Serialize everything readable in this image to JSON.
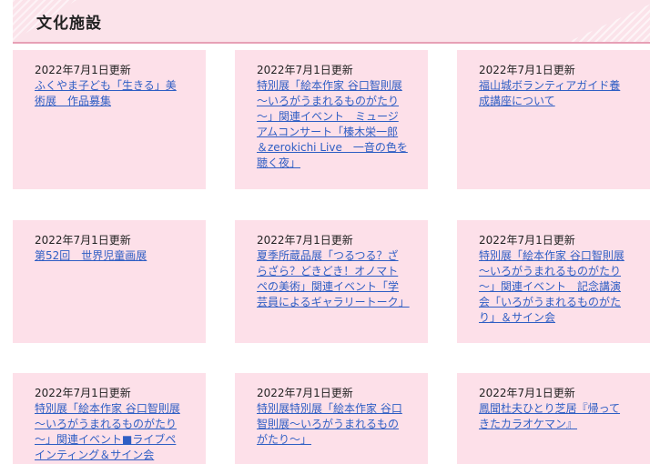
{
  "section": {
    "title": "文化施設"
  },
  "cards": [
    {
      "date": "2022年7月1日更新",
      "link": "ふくやま子ども「生きる」美術展　作品募集"
    },
    {
      "date": "2022年7月1日更新",
      "link": "特別展「絵本作家 谷口智則展～いろがうまれるものがたり～」関連イベント　ミュージアムコンサート「榛木栄一郎＆zerokichi Live　一音の色を聴く夜」"
    },
    {
      "date": "2022年7月1日更新",
      "link": "福山城ボランティアガイド養成講座について"
    },
    {
      "date": "2022年7月1日更新",
      "link": "第52回　世界児童画展"
    },
    {
      "date": "2022年7月1日更新",
      "link": "夏季所蔵品展「つるつる？ざらざら？どきどき！オノマトペの美術」関連イベント「学芸員によるギャラリートーク」"
    },
    {
      "date": "2022年7月1日更新",
      "link": "特別展「絵本作家 谷口智則展～いろがうまれるものがたり～」関連イベント　記念講演会「いろがうまれるものがたり」＆サイン会"
    },
    {
      "date": "2022年7月1日更新",
      "link": "特別展「絵本作家 谷口智則展～いろがうまれるものがたり～」関連イベント■ライブペインティング＆サイン会"
    },
    {
      "date": "2022年7月1日更新",
      "link": "特別展特別展「絵本作家 谷口智則展～いろがうまれるものがたり～」"
    },
    {
      "date": "2022年7月1日更新",
      "link": "鳳聞杜夫ひとり芝居『帰ってきたカラオケマン』"
    }
  ]
}
